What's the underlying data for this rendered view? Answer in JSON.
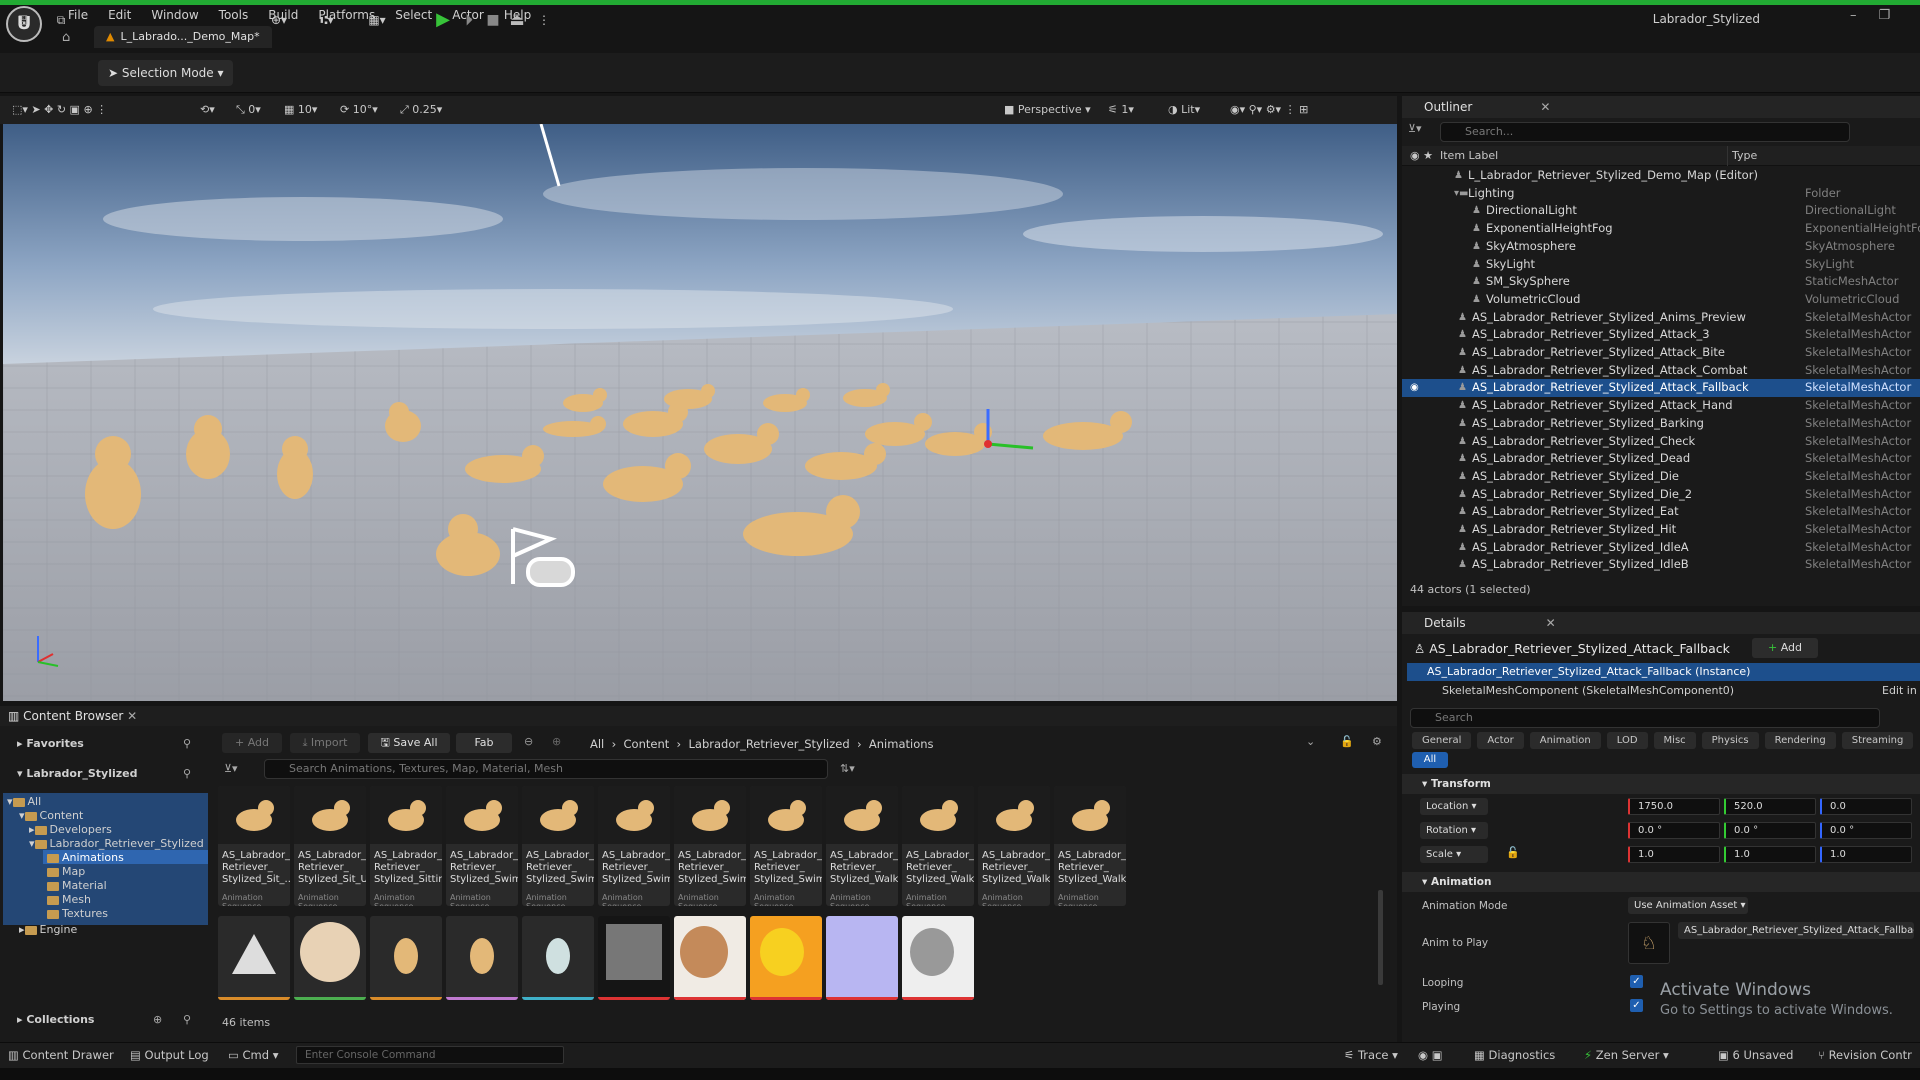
{
  "app": {
    "title": "Labrador_Stylized",
    "logo": "U"
  },
  "menu": [
    "File",
    "Edit",
    "Window",
    "Tools",
    "Build",
    "Platforms",
    "Select",
    "Actor",
    "Help"
  ],
  "doc_tab": "L_Labrado..._Demo_Map*",
  "toolbar": {
    "selection_mode": "Selection Mode"
  },
  "viewport_toolbar": {
    "translate_snap": "0",
    "grid_snap": "10",
    "rotate_snap": "10°",
    "scale_snap": "0.25",
    "view_mode": "Perspective",
    "cam_speed": "1",
    "lighting": "Lit"
  },
  "outliner": {
    "title": "Outliner",
    "search_placeholder": "Search...",
    "col_label": "Item Label",
    "col_type": "Type",
    "rows": [
      {
        "label": "L_Labrador_Retriever_Stylized_Demo_Map (Editor)",
        "type": ""
      },
      {
        "label": "Lighting",
        "type": "Folder"
      },
      {
        "label": "DirectionalLight",
        "type": "DirectionalLight"
      },
      {
        "label": "ExponentialHeightFog",
        "type": "ExponentialHeightFog"
      },
      {
        "label": "SkyAtmosphere",
        "type": "SkyAtmosphere"
      },
      {
        "label": "SkyLight",
        "type": "SkyLight"
      },
      {
        "label": "SM_SkySphere",
        "type": "StaticMeshActor"
      },
      {
        "label": "VolumetricCloud",
        "type": "VolumetricCloud"
      },
      {
        "label": "AS_Labrador_Retriever_Stylized_Anims_Preview",
        "type": "SkeletalMeshActor"
      },
      {
        "label": "AS_Labrador_Retriever_Stylized_Attack_3",
        "type": "SkeletalMeshActor"
      },
      {
        "label": "AS_Labrador_Retriever_Stylized_Attack_Bite",
        "type": "SkeletalMeshActor"
      },
      {
        "label": "AS_Labrador_Retriever_Stylized_Attack_Combat",
        "type": "SkeletalMeshActor"
      },
      {
        "label": "AS_Labrador_Retriever_Stylized_Attack_Fallback",
        "type": "SkeletalMeshActor"
      },
      {
        "label": "AS_Labrador_Retriever_Stylized_Attack_Hand",
        "type": "SkeletalMeshActor"
      },
      {
        "label": "AS_Labrador_Retriever_Stylized_Barking",
        "type": "SkeletalMeshActor"
      },
      {
        "label": "AS_Labrador_Retriever_Stylized_Check",
        "type": "SkeletalMeshActor"
      },
      {
        "label": "AS_Labrador_Retriever_Stylized_Dead",
        "type": "SkeletalMeshActor"
      },
      {
        "label": "AS_Labrador_Retriever_Stylized_Die",
        "type": "SkeletalMeshActor"
      },
      {
        "label": "AS_Labrador_Retriever_Stylized_Die_2",
        "type": "SkeletalMeshActor"
      },
      {
        "label": "AS_Labrador_Retriever_Stylized_Eat",
        "type": "SkeletalMeshActor"
      },
      {
        "label": "AS_Labrador_Retriever_Stylized_Hit",
        "type": "SkeletalMeshActor"
      },
      {
        "label": "AS_Labrador_Retriever_Stylized_IdleA",
        "type": "SkeletalMeshActor"
      },
      {
        "label": "AS_Labrador_Retriever_Stylized_IdleB",
        "type": "SkeletalMeshActor"
      }
    ],
    "footer": "44 actors (1 selected)"
  },
  "details": {
    "title": "Details",
    "actor_name": "AS_Labrador_Retriever_Stylized_Attack_Fallback",
    "add_label": "Add",
    "instance": "AS_Labrador_Retriever_Stylized_Attack_Fallback (Instance)",
    "component": "SkeletalMeshComponent (SkeletalMeshComponent0)",
    "edit_in": "Edit in",
    "search_placeholder": "Search",
    "filter_tabs": [
      "General",
      "Actor",
      "Animation",
      "LOD",
      "Misc",
      "Physics",
      "Rendering",
      "Streaming"
    ],
    "all_tab": "All",
    "transform_header": "Transform",
    "location_label": "Location",
    "location": [
      "1750.0",
      "520.0",
      "0.0"
    ],
    "rotation_label": "Rotation",
    "rotation": [
      "0.0 °",
      "0.0 °",
      "0.0 °"
    ],
    "scale_label": "Scale",
    "scale": [
      "1.0",
      "1.0",
      "1.0"
    ],
    "animation_header": "Animation",
    "anim_mode_label": "Animation Mode",
    "anim_mode_value": "Use Animation Asset",
    "anim_to_play_label": "Anim to Play",
    "anim_to_play_value": "AS_Labrador_Retriever_Stylized_Attack_Fallbac",
    "looping_label": "Looping",
    "playing_label": "Playing",
    "watermark_title": "Activate Windows",
    "watermark_sub": "Go to Settings to activate Windows."
  },
  "content_browser": {
    "tab": "Content Browser",
    "favorites": "Favorites",
    "project": "Labrador_Stylized",
    "tree": [
      "All",
      "Content",
      "Developers",
      "Labrador_Retriever_Stylized",
      "Animations",
      "Map",
      "Material",
      "Mesh",
      "Textures",
      "Engine"
    ],
    "collections": "Collections",
    "add": "Add",
    "import": "Import",
    "save_all": "Save All",
    "fab": "Fab",
    "breadcrumb": [
      "All",
      "Content",
      "Labrador_Retriever_Stylized",
      "Animations"
    ],
    "search_placeholder": "Search Animations, Textures, Map, Material, Mesh",
    "items_count": "46 items",
    "assets": [
      {
        "l1": "AS_Labrador_",
        "l2": "Retriever_",
        "l3": "Stylized_Sit_...",
        "type": "Animation Sequence"
      },
      {
        "l1": "AS_Labrador_",
        "l2": "Retriever_",
        "l3": "Stylized_Sit_UP",
        "type": "Animation Sequence"
      },
      {
        "l1": "AS_Labrador_",
        "l2": "Retriever_",
        "l3": "Stylized_Sitting",
        "type": "Animation Sequence"
      },
      {
        "l1": "AS_Labrador_",
        "l2": "Retriever_",
        "l3": "Stylized_Swim_...",
        "type": "Animation Sequence"
      },
      {
        "l1": "AS_Labrador_",
        "l2": "Retriever_",
        "l3": "Stylized_Swim_...",
        "type": "Animation Sequence"
      },
      {
        "l1": "AS_Labrador_",
        "l2": "Retriever_",
        "l3": "Stylized_Swim_...",
        "type": "Animation Sequence"
      },
      {
        "l1": "AS_Labrador_",
        "l2": "Retriever_",
        "l3": "Stylized_Swim_...",
        "type": "Animation Sequence"
      },
      {
        "l1": "AS_Labrador_",
        "l2": "Retriever_",
        "l3": "Stylized_Swim_...",
        "type": "Animation Sequence"
      },
      {
        "l1": "AS_Labrador_",
        "l2": "Retriever_",
        "l3": "Stylized_Walk_...",
        "type": "Animation Sequence"
      },
      {
        "l1": "AS_Labrador_",
        "l2": "Retriever_",
        "l3": "Stylized_Walk_...",
        "type": "Animation Sequence"
      },
      {
        "l1": "AS_Labrador_",
        "l2": "Retriever_",
        "l3": "Stylized_Walk_...",
        "type": "Animation Sequence"
      },
      {
        "l1": "AS_Labrador_",
        "l2": "Retriever_",
        "l3": "Stylized_Walk_...",
        "type": "Animation Sequence"
      }
    ]
  },
  "statusbar": {
    "content_drawer": "Content Drawer",
    "output_log": "Output Log",
    "cmd": "Cmd",
    "console_placeholder": "Enter Console Command",
    "trace": "Trace",
    "diagnostics": "Diagnostics",
    "zen_server": "Zen Server",
    "unsaved": "6 Unsaved",
    "revision_control": "Revision Contr"
  },
  "colors": {
    "accent_green": "#37c339",
    "selection_blue": "#1d4f8c",
    "folder": "#c69b50"
  }
}
